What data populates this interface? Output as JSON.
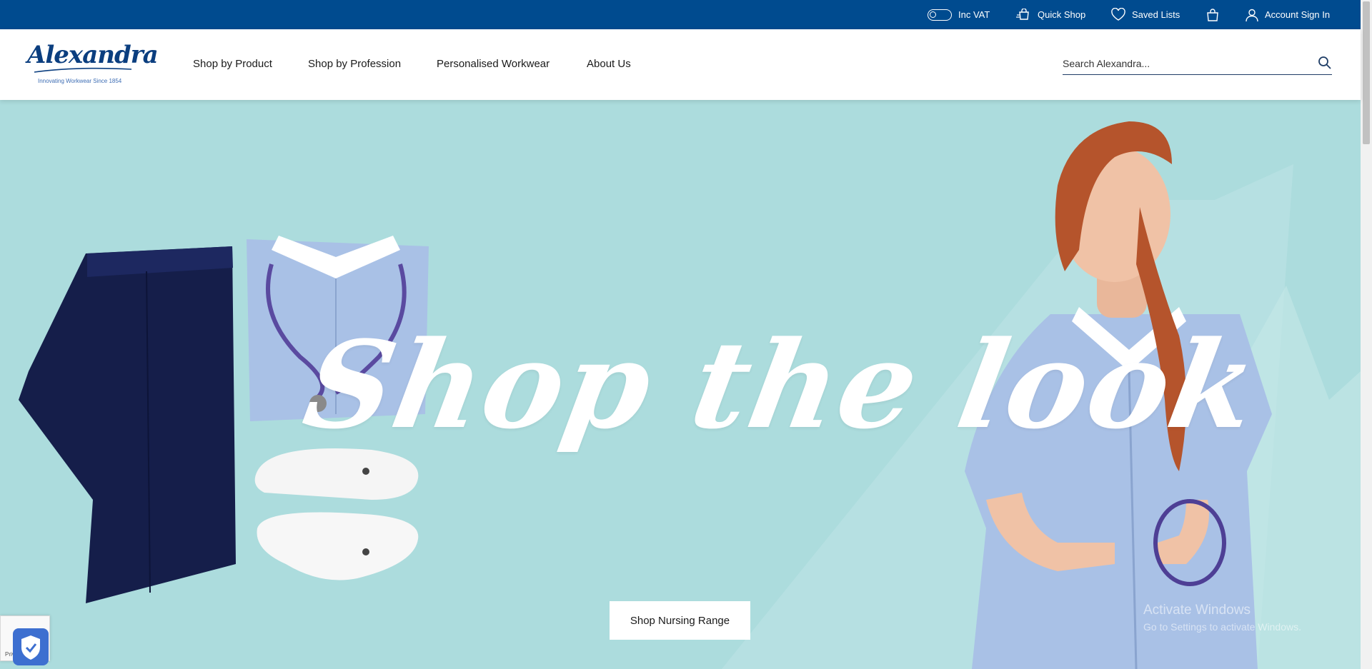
{
  "topbar": {
    "vat_label": "Inc VAT",
    "quick_shop": "Quick Shop",
    "saved_lists": "Saved Lists",
    "account": "Account Sign In"
  },
  "brand": {
    "name": "Alexandra",
    "tagline": "Innovating Workwear Since 1854"
  },
  "nav": {
    "items": [
      "Shop by Product",
      "Shop by Profession",
      "Personalised Workwear",
      "About Us"
    ]
  },
  "search": {
    "placeholder": "Search Alexandra..."
  },
  "hero": {
    "headline": "Shop the look",
    "cta": "Shop Nursing Range"
  },
  "watermark": {
    "line1": "Activate Windows",
    "line2": "Go to Settings to activate Windows."
  },
  "recaptcha": {
    "privacy": "Privacy - Terms"
  },
  "colors": {
    "topbar": "#004b8f",
    "hero_bg": "#acdcdd",
    "navy": "#151e4a",
    "tunic": "#a9c1e6"
  },
  "icons": {
    "vat_toggle": "toggle-icon",
    "quick_shop": "quick-shop-icon",
    "saved_lists": "heart-icon",
    "basket": "bag-icon",
    "account": "user-icon",
    "search": "search-icon"
  }
}
